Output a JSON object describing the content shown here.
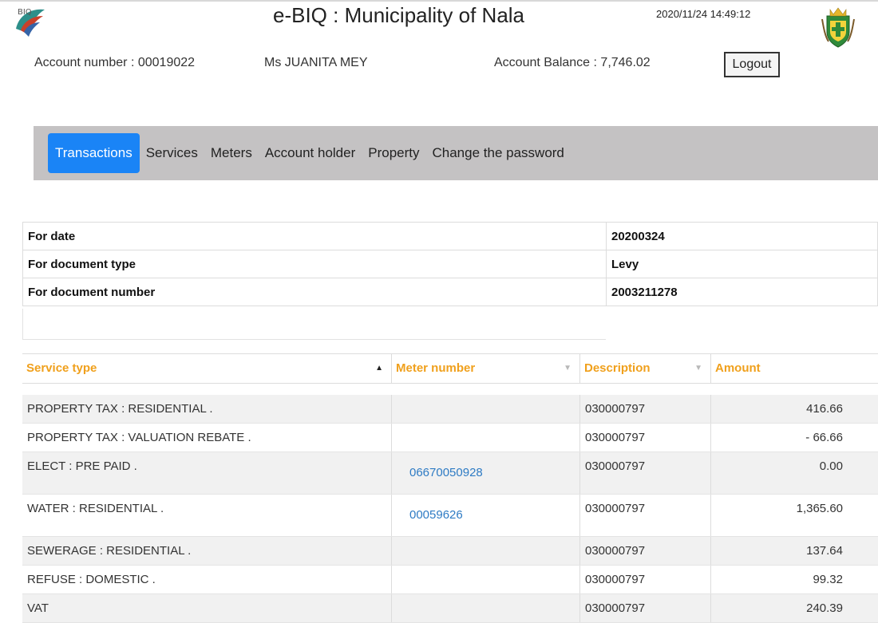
{
  "header": {
    "title": "e-BIQ : Municipality of Nala",
    "datetime": "2020/11/24 14:49:12",
    "logo_left": "ebiq-logo",
    "logo_right": "municipality-crest"
  },
  "account": {
    "number": "Account number : 00019022",
    "holder": "Ms JUANITA MEY",
    "balance": "Account Balance : 7,746.02",
    "logout_label": "Logout"
  },
  "nav": {
    "items": [
      {
        "label": "Transactions"
      },
      {
        "label": "Services"
      },
      {
        "label": "Meters"
      },
      {
        "label": "Account holder"
      },
      {
        "label": "Property"
      },
      {
        "label": "Change the password"
      }
    ],
    "active_index": 0,
    "active_color": "#1a84f6"
  },
  "filters": {
    "rows": [
      {
        "label": "For date",
        "value": "20200324"
      },
      {
        "label": "For document type",
        "value": "Levy"
      },
      {
        "label": "For document number",
        "value": "2003211278"
      }
    ]
  },
  "grid": {
    "header_color": "#f0a01c",
    "columns": [
      {
        "label": "Service type",
        "sort": "asc",
        "icon": "sort-up-icon"
      },
      {
        "label": "Meter number",
        "sort": "none",
        "icon": "sort-down-icon"
      },
      {
        "label": "Description",
        "sort": "none",
        "icon": "sort-down-icon"
      },
      {
        "label": "Amount"
      }
    ],
    "rows": [
      {
        "service": "PROPERTY TAX : RESIDENTIAL .",
        "meter": "",
        "description": "030000797",
        "amount": "416.66"
      },
      {
        "service": "PROPERTY TAX : VALUATION REBATE .",
        "meter": "",
        "description": "030000797",
        "amount": "- 66.66"
      },
      {
        "service": "ELECT : PRE PAID .",
        "meter": "06670050928",
        "description": "030000797",
        "amount": "0.00"
      },
      {
        "service": "WATER : RESIDENTIAL .",
        "meter": "00059626",
        "description": "030000797",
        "amount": "1,365.60"
      },
      {
        "service": "SEWERAGE : RESIDENTIAL .",
        "meter": "",
        "description": "030000797",
        "amount": "137.64"
      },
      {
        "service": "REFUSE : DOMESTIC .",
        "meter": "",
        "description": "030000797",
        "amount": "99.32"
      },
      {
        "service": "VAT",
        "meter": "",
        "description": "030000797",
        "amount": "240.39"
      }
    ]
  }
}
